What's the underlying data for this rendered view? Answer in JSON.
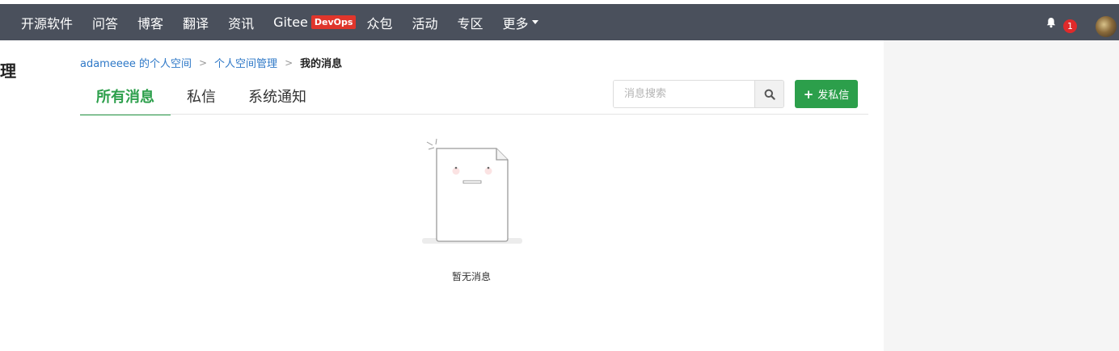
{
  "topnav": {
    "items": [
      "开源软件",
      "问答",
      "博客",
      "翻译",
      "资讯"
    ],
    "gitee": "Gitee",
    "devops": "DevOps",
    "items2": [
      "众包",
      "活动",
      "专区"
    ],
    "more": "更多"
  },
  "notifications": {
    "count": "1"
  },
  "left_fragment": "理",
  "breadcrumb": {
    "space": "adameeee 的个人空间",
    "manage": "个人空间管理",
    "current": "我的消息"
  },
  "tabs": [
    "所有消息",
    "私信",
    "系统通知"
  ],
  "search": {
    "placeholder": "消息搜索"
  },
  "send_button": {
    "label": "发私信"
  },
  "empty": {
    "text": "暂无消息"
  },
  "colors": {
    "topbar": "#4a505c",
    "accent": "#2c9f4b",
    "link": "#2e78c7",
    "badge": "#e02a2a",
    "devops": "#e0362c"
  }
}
